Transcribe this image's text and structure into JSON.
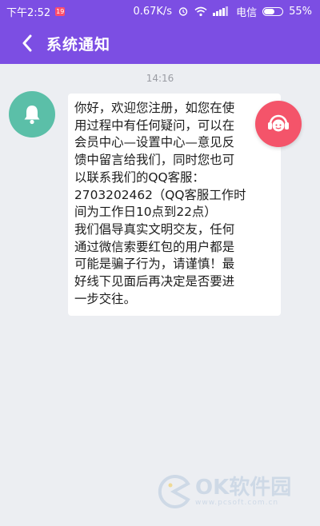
{
  "status_bar": {
    "time": "下午2:52",
    "notification_badge": "19",
    "network_speed": "0.67K/s",
    "carrier": "电信",
    "battery_percent": "55%",
    "battery_level": 0.55
  },
  "header": {
    "title": "系统通知",
    "background_color": "#7c4ee3"
  },
  "conversation": {
    "timestamp": "14:16",
    "message": "你好，欢迎您注册，如您在使\n用过程中有任何疑问，可以在\n会员中心—设置中心—意见反\n馈中留言给我们，同时您也可\n以联系我们的QQ客服：\n2703202462（QQ客服工作时\n间为工作日10点到22点）\n我们倡导真实文明交友，任何\n通过微信索要红包的用户都是\n可能是骗子行为，请谨慎！最\n好线下见面后再决定是否要进\n一步交往。"
  },
  "icons": {
    "avatar": "bell-icon",
    "avatar_color": "#5bbfa8",
    "support": "headset-icon",
    "support_color": "#f4546a",
    "back": "chevron-left-icon"
  },
  "watermark": {
    "brand": "OK软件园",
    "url": "www.pcsoft.com.cn"
  }
}
